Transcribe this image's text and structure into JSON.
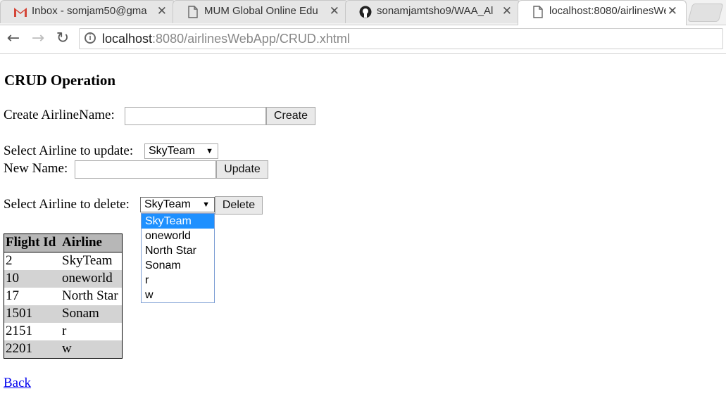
{
  "browser": {
    "tabs": [
      {
        "icon": "gmail-icon",
        "title": "Inbox - somjam50@gma",
        "active": false
      },
      {
        "icon": "document-icon",
        "title": "MUM Global Online Edu",
        "active": false
      },
      {
        "icon": "github-icon",
        "title": "sonamjamtsho9/WAA_Al",
        "active": false
      },
      {
        "icon": "document-icon",
        "title": "localhost:8080/airlinesWe",
        "active": true
      }
    ],
    "url_host": "localhost",
    "url_path": ":8080/airlinesWebApp/CRUD.xhtml"
  },
  "page": {
    "heading": "CRUD Operation",
    "create": {
      "label": "Create AirlineName:",
      "value": "",
      "button": "Create"
    },
    "update": {
      "select_label": "Select Airline to update:",
      "selected": "SkyTeam",
      "new_name_label": "New Name:",
      "new_name_value": "",
      "button": "Update"
    },
    "delete": {
      "select_label": "Select Airline to delete:",
      "selected": "SkyTeam",
      "button": "Delete",
      "options": [
        "SkyTeam",
        "oneworld",
        "North Star",
        "Sonam",
        "r",
        "w"
      ]
    },
    "table": {
      "headers": [
        "Flight Id",
        "Airline"
      ],
      "rows": [
        [
          "2",
          "SkyTeam"
        ],
        [
          "10",
          "oneworld"
        ],
        [
          "17",
          "North Star"
        ],
        [
          "1501",
          "Sonam"
        ],
        [
          "2151",
          "r"
        ],
        [
          "2201",
          "w"
        ]
      ]
    },
    "back_link": "Back"
  }
}
